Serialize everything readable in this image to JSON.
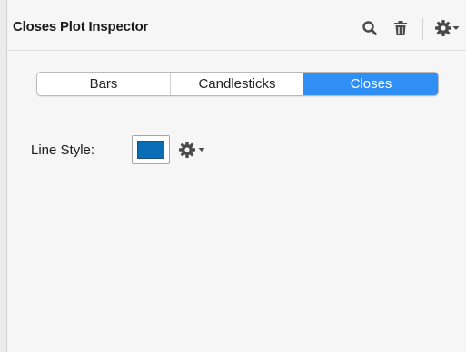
{
  "inspector": {
    "title": "Closes Plot Inspector",
    "icons": [
      "search-icon",
      "trash-icon",
      "gear-icon",
      "chevron-down-icon"
    ]
  },
  "plot_type": {
    "options": [
      "Bars",
      "Candlesticks",
      "Closes"
    ],
    "selected": "Closes"
  },
  "line_style": {
    "label": "Line Style:",
    "color": "#0a6db5"
  },
  "colors": {
    "accent": "#2f8ff5",
    "icon": "#4a4a4a"
  }
}
